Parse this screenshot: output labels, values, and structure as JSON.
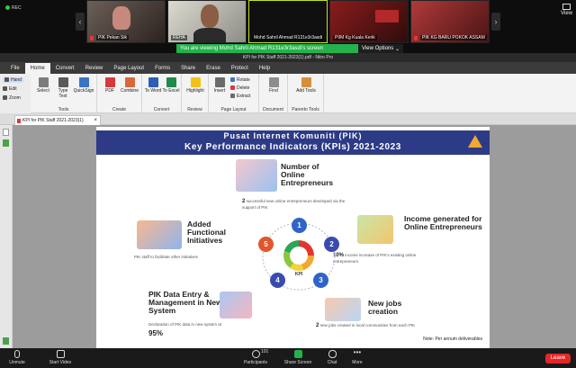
{
  "zoom": {
    "recording_label": "REC",
    "view_label": "View",
    "participants": [
      {
        "name": "PIK Pekan Sik"
      },
      {
        "name": "REHA"
      },
      {
        "name": "Mohd Sahril Ahmad R131e3r3asdi"
      },
      {
        "name": "PIIM Kg Kuala Kerik"
      },
      {
        "name": "PIK KG BARU POKOK ASSAM"
      }
    ],
    "sharing_banner": "You are viewing Mohd Sahril Ahmad R131e3r3asdi's screen",
    "view_options_label": "View Options",
    "toolbar": {
      "unmute": "Unmute",
      "start_video": "Start Video",
      "participants": "Participants",
      "participants_count": "101",
      "share_screen": "Share Screen",
      "chat": "Chat",
      "more": "More",
      "leave": "Leave"
    },
    "colors": {
      "share_green": "#24b24b",
      "leave_red": "#e02828"
    }
  },
  "pdf_app": {
    "window_title": "KPI for PIK Staff 2021-2023(1).pdf - Nitro Pro",
    "tabs": [
      "File",
      "Home",
      "Convert",
      "Review",
      "Page Layout",
      "Forms",
      "Share",
      "Erase",
      "Protect",
      "Help"
    ],
    "active_tab": "Home",
    "tool_palette": {
      "hand": "Hand",
      "edit": "Edit",
      "zoom": "Zoom"
    },
    "groups": {
      "tools": "Tools",
      "create": "Create",
      "convert": "Convert",
      "review": "Review",
      "page_layout": "Page Layout",
      "document": "Document",
      "parento_tools": "Parento Tools"
    },
    "buttons": {
      "select": "Select",
      "type_text": "Type Text",
      "quicksign": "QuickSign",
      "pdf": "PDF",
      "combine": "Combine",
      "to_word": "To Word",
      "to_excel": "To Excel",
      "highlight": "Highlight",
      "insert": "Insert",
      "rotate": "Rotate",
      "delete": "Delete",
      "extract": "Extract",
      "find": "Find",
      "add_tools": "Add Tools"
    },
    "doc_tab": "KPI for PIK Staff 2021-2023(1)"
  },
  "slide": {
    "title_line1": "Pusat Internet Komuniti (PIK)",
    "title_line2": "Key Performance Indicators (KPIs) 2021-2023",
    "center_label": "KPI",
    "numbers": [
      "1",
      "2",
      "3",
      "4",
      "5"
    ],
    "kpis": {
      "online_entrepreneurs": {
        "title": "Number of Online Entrepreneurs",
        "value": "2",
        "desc": "successful new online entrepreneurs developed via the support of PIK"
      },
      "income": {
        "title": "Income generated for Online Entrepreneurs",
        "value": "10%",
        "desc": "income increase of PIK's existing online entrepreneurs"
      },
      "initiatives": {
        "title": "Added Functional Initiatives",
        "desc": "PIK staff to facilitate other initiatives"
      },
      "data_entry": {
        "title": "PIK Data Entry & Management in New System",
        "desc": "Declaration of PIK data in new system at",
        "value": "95%"
      },
      "jobs": {
        "title": "New jobs creation",
        "value": "2",
        "desc": "new jobs created in local communities from each PIK"
      }
    },
    "note": "Note: Per annum deliverables",
    "colors": {
      "header": "#2d3b86",
      "c1": "#2f63c8",
      "c2": "#3a4bb0",
      "c3": "#2f63c8",
      "c4": "#3a4bb0",
      "c5": "#e0562d"
    }
  }
}
